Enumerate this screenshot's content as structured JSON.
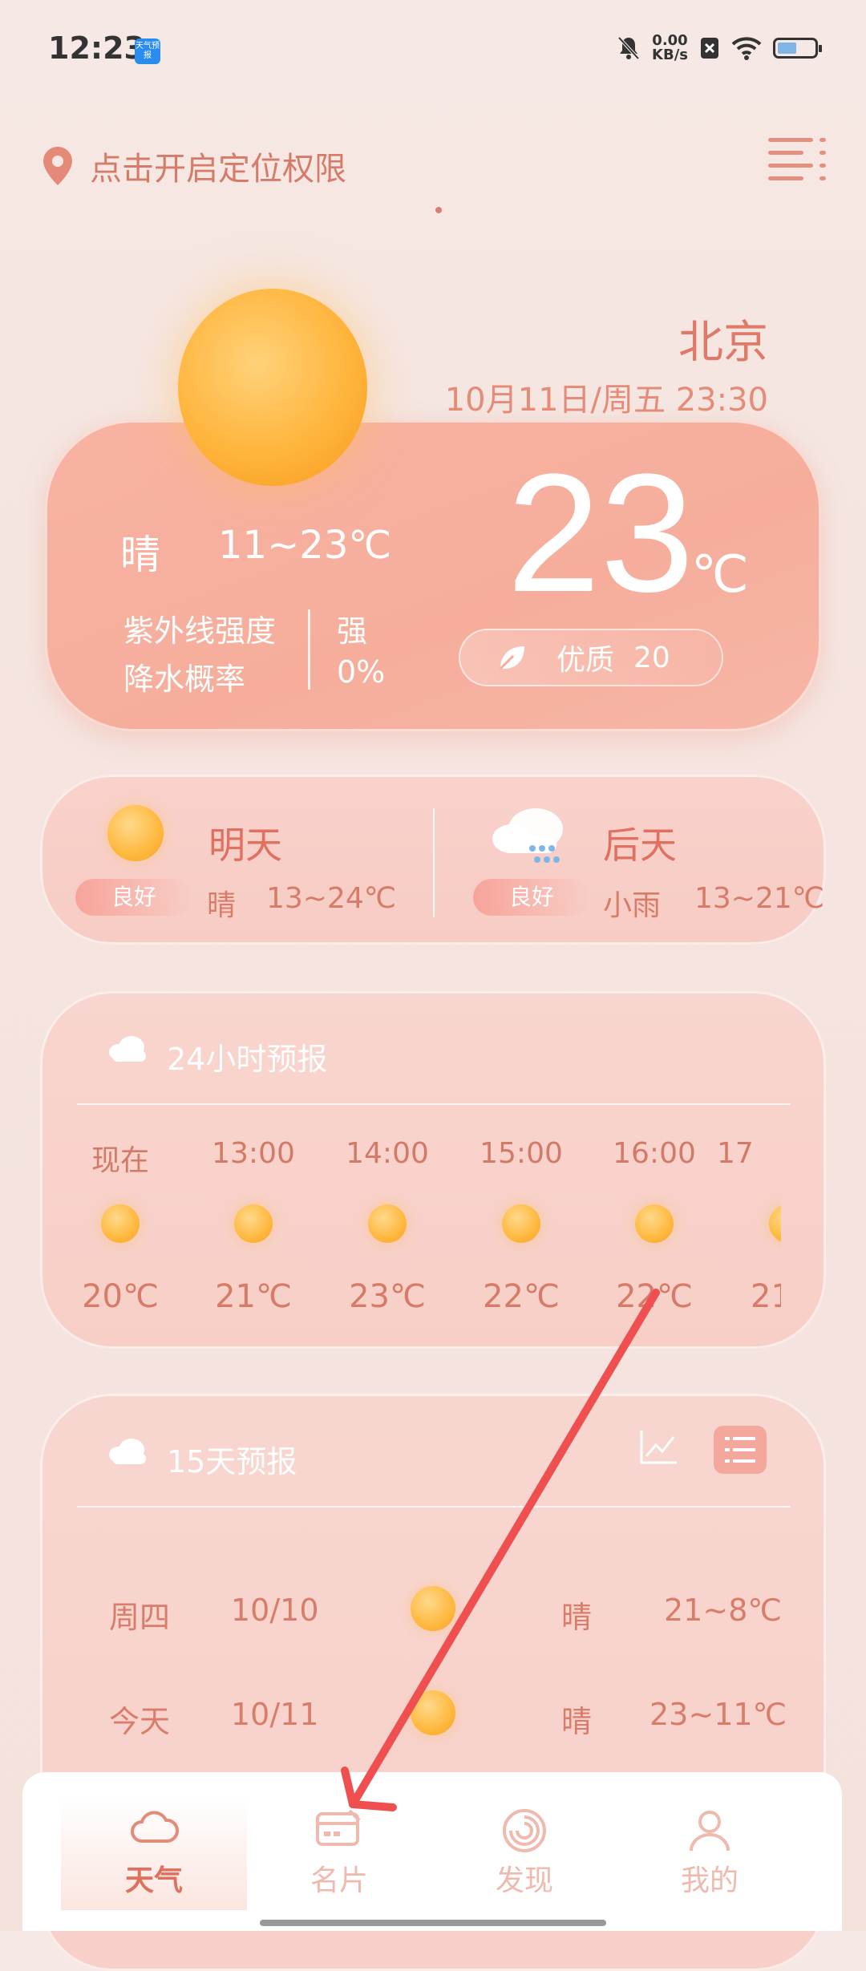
{
  "status_bar": {
    "time": "12:23",
    "app_badge": "天气预报",
    "net_speed_value": "0.00",
    "net_speed_unit": "KB/s"
  },
  "header": {
    "location_prompt": "点击开启定位权限"
  },
  "current": {
    "city": "北京",
    "datetime": "10月11日/周五 23:30",
    "condition": "晴",
    "range": "11~23℃",
    "uv_label": "紫外线强度",
    "uv_value": "强",
    "rain_label": "降水概率",
    "rain_value": "0%",
    "temp": "23",
    "temp_unit": "℃",
    "aqi_label": "优质",
    "aqi_value": "20"
  },
  "two_day": [
    {
      "name": "明天",
      "air": "良好",
      "cond": "晴",
      "range": "13~24℃",
      "icon": "sun-icon"
    },
    {
      "name": "后天",
      "air": "良好",
      "cond": "小雨",
      "range": "13~21℃",
      "icon": "light-rain-icon"
    }
  ],
  "hourly": {
    "title": "24小时预报",
    "items": [
      {
        "time": "现在",
        "temp": "20℃"
      },
      {
        "time": "13:00",
        "temp": "21℃"
      },
      {
        "time": "14:00",
        "temp": "23℃"
      },
      {
        "time": "15:00",
        "temp": "22℃"
      },
      {
        "time": "16:00",
        "temp": "22℃"
      },
      {
        "time": "17",
        "temp": "21"
      }
    ]
  },
  "fifteen": {
    "title": "15天预报",
    "rows": [
      {
        "day": "周四",
        "date": "10/10",
        "cond": "晴",
        "range": "21~8℃"
      },
      {
        "day": "今天",
        "date": "10/11",
        "cond": "晴",
        "range": "23~11℃"
      }
    ]
  },
  "nav": [
    {
      "label": "天气",
      "icon": "cloud-icon"
    },
    {
      "label": "名片",
      "icon": "card-icon"
    },
    {
      "label": "发现",
      "icon": "discover-icon"
    },
    {
      "label": "我的",
      "icon": "profile-icon"
    }
  ],
  "colors": {
    "accent": "#e07a68",
    "card": "#f7b1a1",
    "annotation_arrow": "#ef4f4f"
  }
}
